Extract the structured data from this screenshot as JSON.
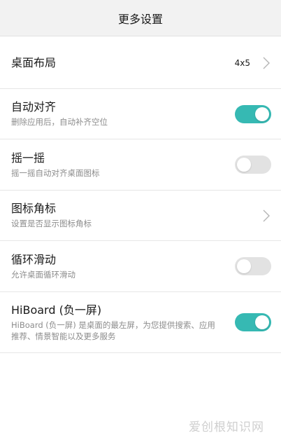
{
  "header": {
    "title": "更多设置"
  },
  "items": [
    {
      "title": "桌面布局",
      "value": "4x5",
      "control": "chevron"
    },
    {
      "title": "自动对齐",
      "subtitle": "删除应用后，自动补齐空位",
      "control": "toggle",
      "state": "on"
    },
    {
      "title": "摇一摇",
      "subtitle": "摇一摇自动对齐桌面图标",
      "control": "toggle",
      "state": "off"
    },
    {
      "title": "图标角标",
      "subtitle": "设置是否显示图标角标",
      "control": "chevron"
    },
    {
      "title": "循环滑动",
      "subtitle": "允许桌面循环滑动",
      "control": "toggle",
      "state": "off"
    },
    {
      "title": "HiBoard (负一屏)",
      "subtitle": "HiBoard (负一屏) 是桌面的最左屏，为您提供搜索、应用推荐、情景智能以及更多服务",
      "control": "toggle",
      "state": "on"
    }
  ],
  "watermark": "爱创根知识网",
  "colors": {
    "toggle_on": "#36b9b3",
    "toggle_off": "#e2e2e2",
    "header_bg": "#f2f2f2"
  }
}
